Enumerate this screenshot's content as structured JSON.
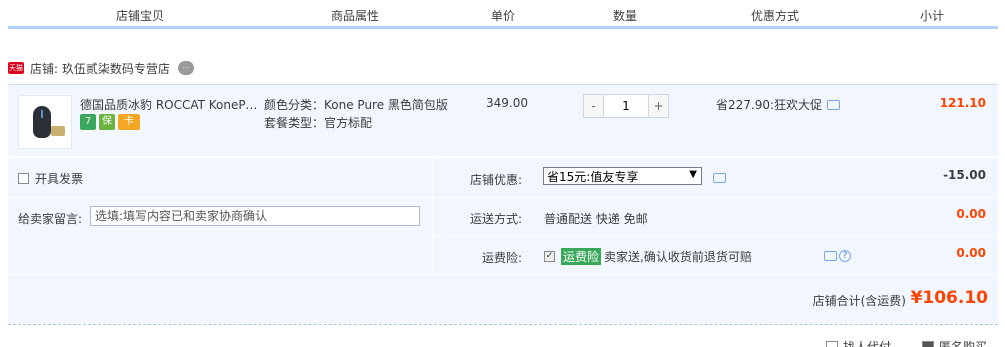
{
  "header": {
    "col_shop_item": "店铺宝贝",
    "col_attributes": "商品属性",
    "col_unit_price": "单价",
    "col_quantity": "数量",
    "col_discount": "优惠方式",
    "col_subtotal": "小计"
  },
  "shop": {
    "badge": "天猫",
    "label": "店铺: 玖伍贰柒数码专营店",
    "chat_icon": "chat-bubble-icon"
  },
  "item": {
    "title": "德国品质冰豹 ROCCAT KonePure 游戏鼠标",
    "attr_color": "颜色分类：Kone Pure 黑色简包版",
    "attr_package": "套餐类型：官方标配",
    "unit_price": "349.00",
    "qty_minus": "-",
    "quantity": "1",
    "qty_plus": "+",
    "promotion": "省227.90:狂欢大促",
    "subtotal": "121.10",
    "service_icons": [
      "7",
      "保",
      "卡"
    ]
  },
  "options": {
    "invoice_label": "开具发票",
    "message_label": "给卖家留言:",
    "message_placeholder": "选填:填写内容已和卖家协商确认",
    "shop_discount_label": "店铺优惠:",
    "shop_discount_selected": "省15元:值友专享",
    "shop_discount_amount": "-15.00",
    "shipping_label": "运送方式:",
    "shipping_value": "普通配送 快递 免邮",
    "shipping_amount": "0.00",
    "insurance_label": "运费险:",
    "insurance_tag": "运费险",
    "insurance_text": "卖家送,确认收货前退货可赔",
    "insurance_amount": "0.00"
  },
  "totals": {
    "label": "店铺合计(含运费)",
    "amount": "¥106.10"
  },
  "footer": {
    "proxy_pay": "找人代付",
    "anonymous": "匿名购买"
  },
  "colors": {
    "accent_red": "#ff4400",
    "row_bg": "#f2f7ff",
    "header_line": "#b2d1ff"
  }
}
